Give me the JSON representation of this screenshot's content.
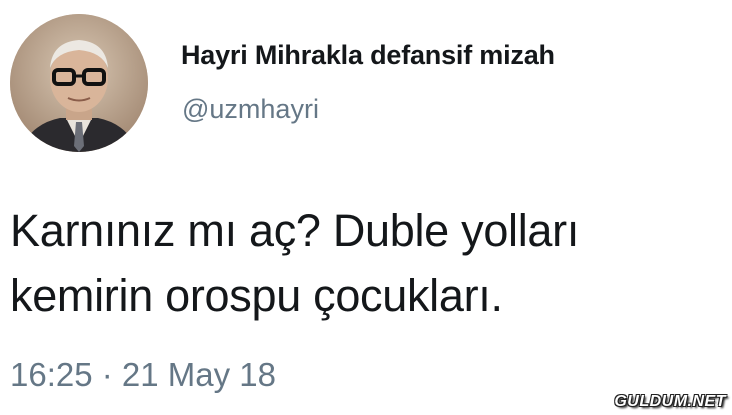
{
  "tweet": {
    "author": {
      "display_name": "Hayri Mihrakla defansif mizah",
      "handle": "@uzmhayri",
      "avatar": "avatar-photo"
    },
    "text_lines": [
      "Karnınız mı aç? Duble yolları",
      "kemirin orospu çocukları."
    ],
    "timestamp": "16:25 · 21 May 18"
  },
  "watermark": "GULDUM.NET",
  "colors": {
    "background": "#ffffff",
    "primary_text": "#14171a",
    "secondary_text": "#657786"
  }
}
